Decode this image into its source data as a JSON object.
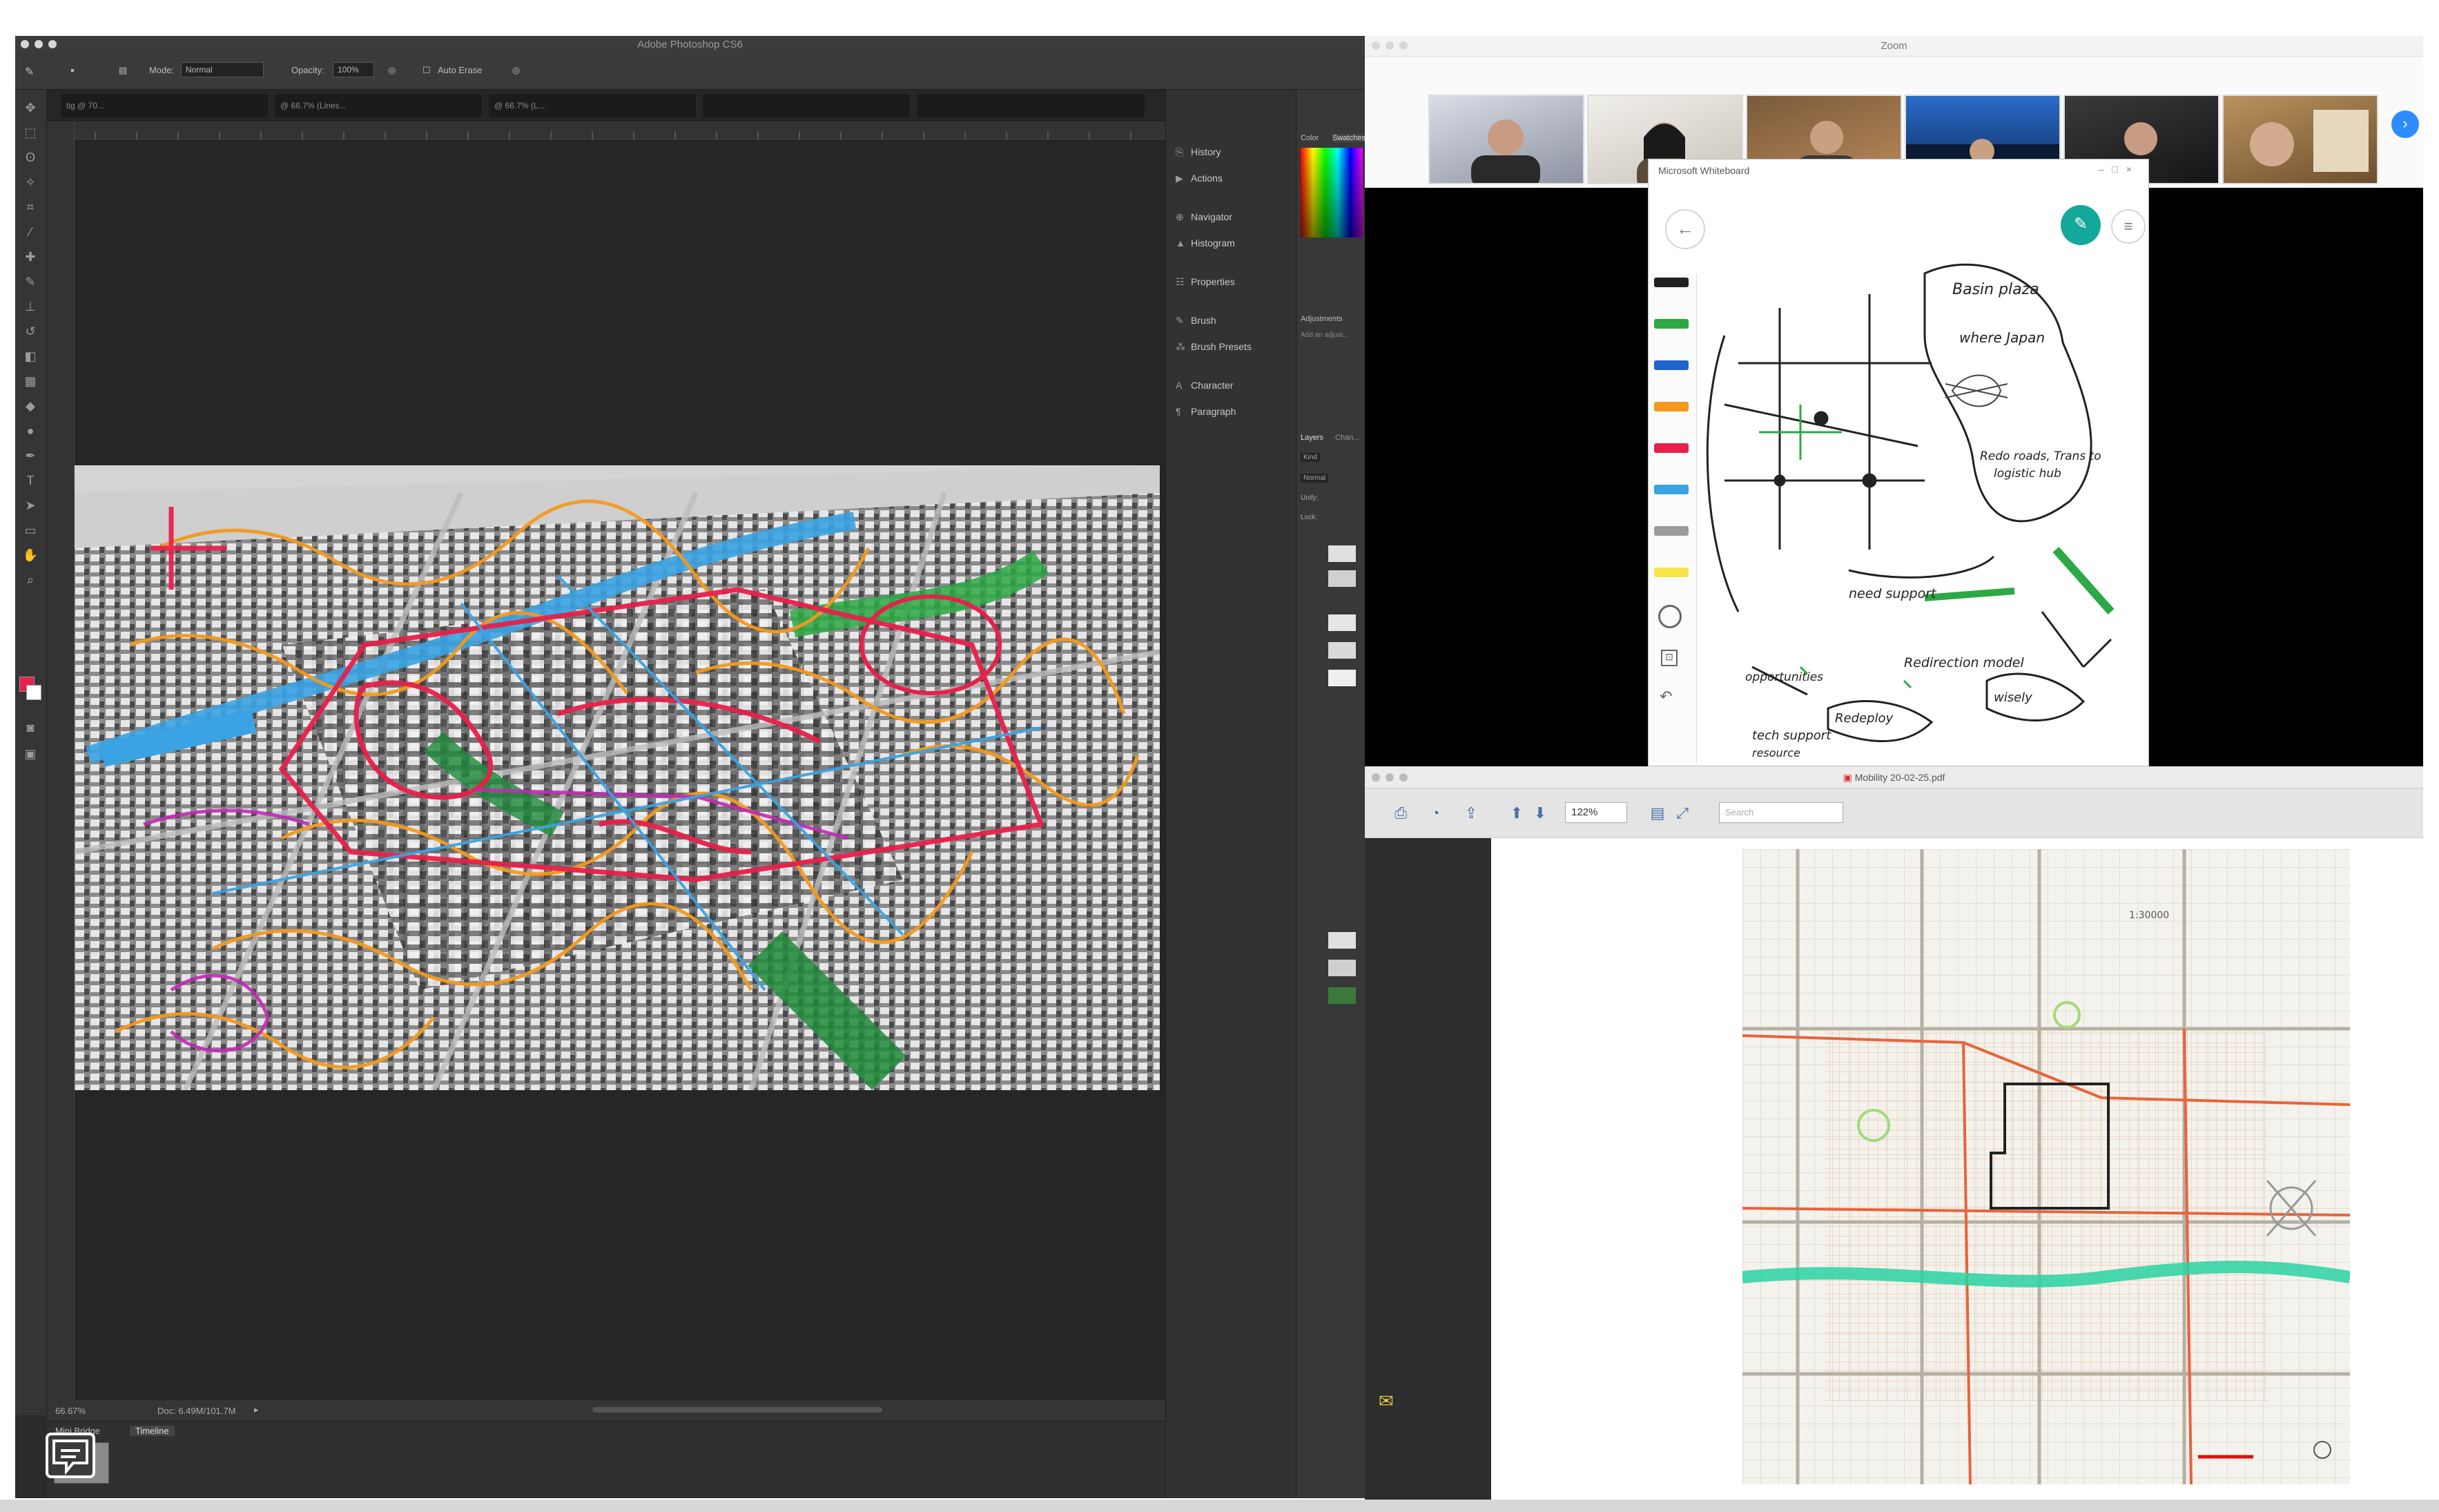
{
  "photoshop": {
    "title": "Adobe Photoshop CS6",
    "options": {
      "mode_label": "Mode:",
      "mode_value": "Normal",
      "opacity_label": "Opacity:",
      "opacity_value": "100%",
      "auto_erase": "Auto Erase"
    },
    "tabs": [
      "tig @ 70...",
      "@ 66.7% (Lines...",
      "@ 66.7% (L..."
    ],
    "panels": [
      {
        "label": "History",
        "icon": "history-icon"
      },
      {
        "label": "Actions",
        "icon": "play-icon"
      },
      {
        "label": "Navigator",
        "icon": "navigator-icon"
      },
      {
        "label": "Histogram",
        "icon": "histogram-icon"
      },
      {
        "label": "Properties",
        "icon": "properties-icon"
      },
      {
        "label": "Brush",
        "icon": "brush-icon"
      },
      {
        "label": "Brush Presets",
        "icon": "brush-presets-icon"
      },
      {
        "label": "Character",
        "icon": "character-icon"
      },
      {
        "label": "Paragraph",
        "icon": "paragraph-icon"
      }
    ],
    "right_panel": {
      "color_tab": "Color",
      "swatches_tab": "Swatches",
      "adjustments_title": "Adjustments",
      "add_adjustment": "Add an adjust...",
      "layers_tab": "Layers",
      "channels_tab": "Chan...",
      "kind": "Kind",
      "blend": "Normal",
      "lock": "Lock:",
      "unify": "Unify:"
    },
    "status": {
      "zoom": "66.67%",
      "doc": "Doc: 6.49M/101.7M"
    },
    "bottom_tabs": [
      "Mini Bridge",
      "Timeline"
    ]
  },
  "zoom": {
    "title": "Zoom",
    "next_arrow": "›"
  },
  "whiteboard": {
    "title": "Microsoft Whiteboard",
    "notes": [
      "Basin plaza",
      "where Japan",
      "Redo roads, Trans to",
      "logistic hub",
      "need support",
      "opportunities",
      "Redirection model",
      "Redeploy",
      "wisely",
      "tech support",
      "resource"
    ]
  },
  "pdf": {
    "title": "Mobility 20-02-25.pdf",
    "zoom": "122%",
    "search_placeholder": "Search",
    "map_scale": "1:30000"
  },
  "colors": {
    "ps_bg": "#2b2b2b",
    "zoom_blue": "#2d8cff",
    "whiteboard_teal": "#14a89a",
    "sketch_orange": "#f39a1e",
    "sketch_red": "#e8204b",
    "sketch_blue": "#3aa3e3",
    "sketch_green": "#2ca844"
  }
}
